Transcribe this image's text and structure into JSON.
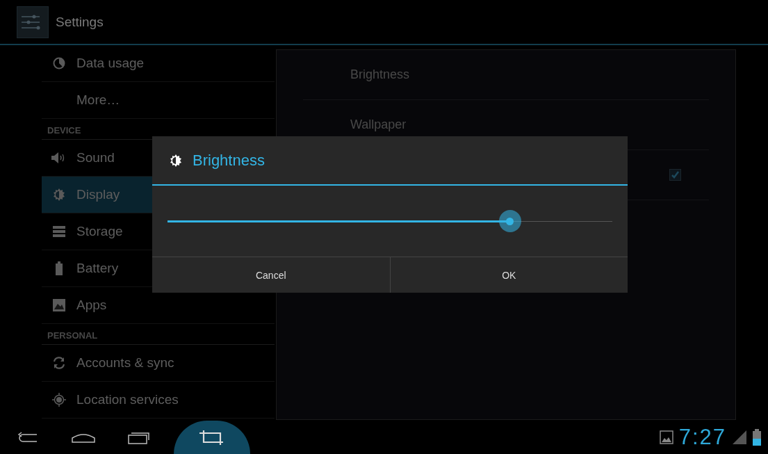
{
  "action_bar": {
    "title": "Settings"
  },
  "sidebar": {
    "items": [
      {
        "kind": "item",
        "label": "Data usage",
        "selected": false
      },
      {
        "kind": "item",
        "label": "More…",
        "selected": false
      },
      {
        "kind": "header",
        "label": "DEVICE"
      },
      {
        "kind": "item",
        "label": "Sound",
        "selected": false
      },
      {
        "kind": "item",
        "label": "Display",
        "selected": true
      },
      {
        "kind": "item",
        "label": "Storage",
        "selected": false
      },
      {
        "kind": "item",
        "label": "Battery",
        "selected": false
      },
      {
        "kind": "item",
        "label": "Apps",
        "selected": false
      },
      {
        "kind": "header",
        "label": "PERSONAL"
      },
      {
        "kind": "item",
        "label": "Accounts & sync",
        "selected": false
      },
      {
        "kind": "item",
        "label": "Location services",
        "selected": false
      }
    ]
  },
  "display_settings": [
    {
      "kind": "plain",
      "label": "Brightness"
    },
    {
      "kind": "plain",
      "label": "Wallpaper"
    },
    {
      "kind": "checkbox",
      "checked": true
    }
  ],
  "dialog": {
    "title": "Brightness",
    "slider": {
      "level": 0.77
    },
    "buttons": [
      "Cancel",
      "OK"
    ]
  },
  "status_bar": {
    "time": "7:27"
  }
}
